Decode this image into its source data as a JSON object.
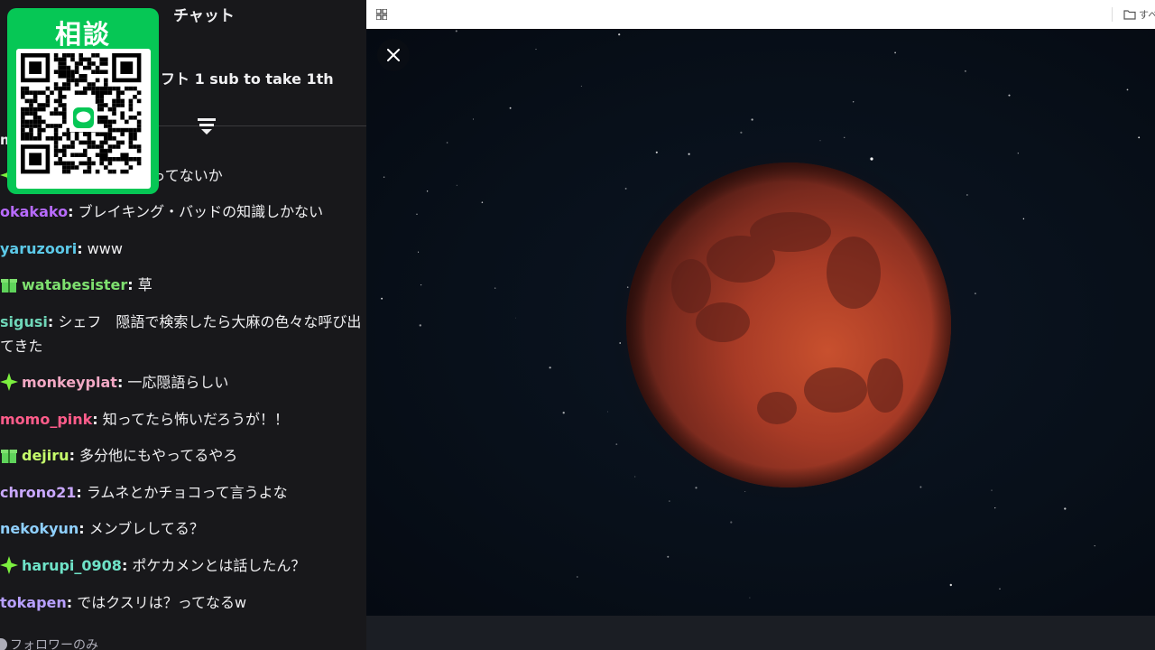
{
  "chat": {
    "title": "チャット",
    "pinned_text": "フト 1 sub to take 1th",
    "stub_letter": "m",
    "messages": [
      {
        "user": "",
        "text": "イキングバッドで言ってないか",
        "color": "#efeff1",
        "badge": "sparkle"
      },
      {
        "user": "okakako",
        "text": " ブレイキング・バッドの知識しかない",
        "color": "#b86bff",
        "badge": ""
      },
      {
        "user": "yaruzoori",
        "text": " www",
        "color": "#5cc9e8",
        "badge": ""
      },
      {
        "user": "watabesister",
        "text": " 草",
        "color": "#7ee06f",
        "badge": "gift"
      },
      {
        "user": "sigusi",
        "text": " シェフ　隠語で検索したら大麻の色々な呼び出てきた",
        "color": "#6fd6b8",
        "badge": ""
      },
      {
        "user": "monkeyplat",
        "text": " 一応隠語らしい",
        "color": "#f2a8c4",
        "badge": "sparkle"
      },
      {
        "user": "momo_pink",
        "text": " 知ってたら怖いだろうが！！",
        "color": "#ff5c8a",
        "badge": ""
      },
      {
        "user": "dejiru",
        "text": " 多分他にもやってるやろ",
        "color": "#c6ff6b",
        "badge": "gift"
      },
      {
        "user": "chrono21",
        "text": " ラムネとかチョコって言うよな",
        "color": "#c9a8ff",
        "badge": ""
      },
      {
        "user": "nekokyun",
        "text": " メンブレしてる？",
        "color": "#8fd0ff",
        "badge": ""
      },
      {
        "user": "harupi_0908",
        "text": " ポケカメンとは話したん？",
        "color": "#6fe3c8",
        "badge": "sparkle"
      },
      {
        "user": "tokapen",
        "text": " ではクスリは？ってなるw",
        "color": "#b8a0ff",
        "badge": ""
      }
    ],
    "follower_note": "フォロワーのみ"
  },
  "consult": {
    "label": "相談"
  },
  "viewer": {
    "folder_text": "すべ"
  },
  "colors": {
    "line_green": "#06c755",
    "chat_bg": "#18181b",
    "moon_red": "#b2402a"
  },
  "icons": [
    "collapse-icon",
    "sparkle-badge-icon",
    "gift-badge-icon",
    "qr-code",
    "line-logo-icon",
    "grid-icon",
    "folder-icon",
    "close-icon"
  ]
}
